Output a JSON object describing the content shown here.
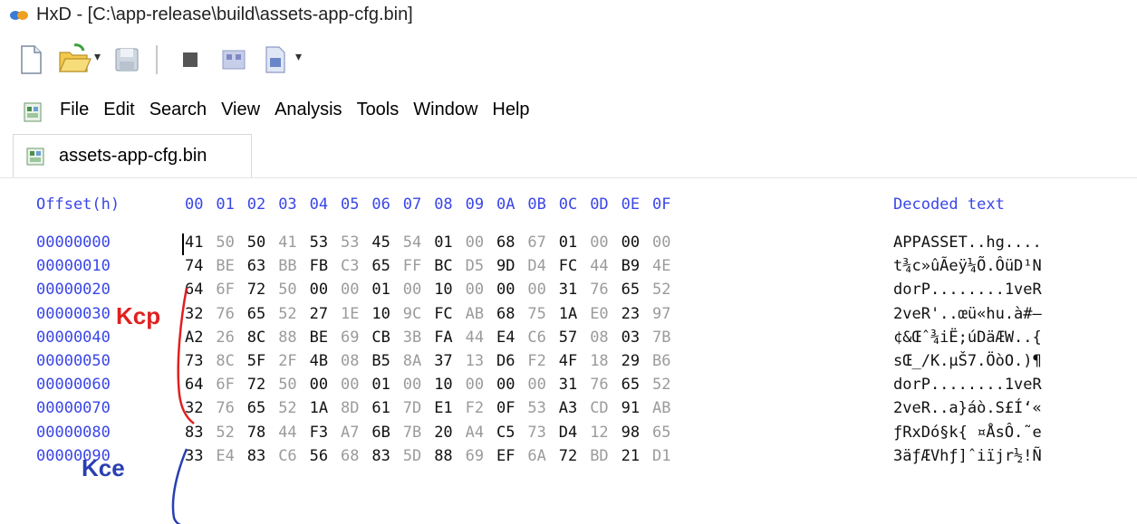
{
  "window": {
    "title": "HxD - [C:\\app-release\\build\\assets-app-cfg.bin]"
  },
  "toolbar": {
    "buttons": [
      {
        "icon": "new-file-icon"
      },
      {
        "icon": "open-folder-icon"
      },
      {
        "icon": "save-disk-icon"
      },
      {
        "icon": "close-icon"
      },
      {
        "icon": "ram-editor-icon"
      },
      {
        "icon": "disk-editor-icon"
      }
    ]
  },
  "menu": {
    "items": [
      "File",
      "Edit",
      "Search",
      "View",
      "Analysis",
      "Tools",
      "Window",
      "Help"
    ]
  },
  "tab": {
    "label": "assets-app-cfg.bin"
  },
  "hex_view": {
    "offset_header": "Offset(h)",
    "column_headers": [
      "00",
      "01",
      "02",
      "03",
      "04",
      "05",
      "06",
      "07",
      "08",
      "09",
      "0A",
      "0B",
      "0C",
      "0D",
      "0E",
      "0F"
    ],
    "decoded_header": "Decoded text",
    "rows": [
      {
        "offset": "00000000",
        "bytes": [
          "41",
          "50",
          "50",
          "41",
          "53",
          "53",
          "45",
          "54",
          "01",
          "00",
          "68",
          "67",
          "01",
          "00",
          "00",
          "00"
        ],
        "decoded": "APPASSET..hg...."
      },
      {
        "offset": "00000010",
        "bytes": [
          "74",
          "BE",
          "63",
          "BB",
          "FB",
          "C3",
          "65",
          "FF",
          "BC",
          "D5",
          "9D",
          "D4",
          "FC",
          "44",
          "B9",
          "4E"
        ],
        "decoded": "t¾c»ûÃeÿ¼Õ.ÔüD¹N"
      },
      {
        "offset": "00000020",
        "bytes": [
          "64",
          "6F",
          "72",
          "50",
          "00",
          "00",
          "01",
          "00",
          "10",
          "00",
          "00",
          "00",
          "31",
          "76",
          "65",
          "52"
        ],
        "decoded": "dorP........1veR"
      },
      {
        "offset": "00000030",
        "bytes": [
          "32",
          "76",
          "65",
          "52",
          "27",
          "1E",
          "10",
          "9C",
          "FC",
          "AB",
          "68",
          "75",
          "1A",
          "E0",
          "23",
          "97"
        ],
        "decoded": "2veR'..œü«hu.à#—"
      },
      {
        "offset": "00000040",
        "bytes": [
          "A2",
          "26",
          "8C",
          "88",
          "BE",
          "69",
          "CB",
          "3B",
          "FA",
          "44",
          "E4",
          "C6",
          "57",
          "08",
          "03",
          "7B"
        ],
        "decoded": "¢&Œˆ¾iË;úDäÆW..{"
      },
      {
        "offset": "00000050",
        "bytes": [
          "73",
          "8C",
          "5F",
          "2F",
          "4B",
          "08",
          "B5",
          "8A",
          "37",
          "13",
          "D6",
          "F2",
          "4F",
          "18",
          "29",
          "B6"
        ],
        "decoded": "sŒ_/K.µŠ7.ÖòO.)¶"
      },
      {
        "offset": "00000060",
        "bytes": [
          "64",
          "6F",
          "72",
          "50",
          "00",
          "00",
          "01",
          "00",
          "10",
          "00",
          "00",
          "00",
          "31",
          "76",
          "65",
          "52"
        ],
        "decoded": "dorP........1veR"
      },
      {
        "offset": "00000070",
        "bytes": [
          "32",
          "76",
          "65",
          "52",
          "1A",
          "8D",
          "61",
          "7D",
          "E1",
          "F2",
          "0F",
          "53",
          "A3",
          "CD",
          "91",
          "AB"
        ],
        "decoded": "2veR..a}áò.S£Í‘«"
      },
      {
        "offset": "00000080",
        "bytes": [
          "83",
          "52",
          "78",
          "44",
          "F3",
          "A7",
          "6B",
          "7B",
          "20",
          "A4",
          "C5",
          "73",
          "D4",
          "12",
          "98",
          "65"
        ],
        "decoded": "ƒRxDó§k{ ¤ÅsÔ.˜e"
      },
      {
        "offset": "00000090",
        "bytes": [
          "33",
          "E4",
          "83",
          "C6",
          "56",
          "68",
          "83",
          "5D",
          "88",
          "69",
          "EF",
          "6A",
          "72",
          "BD",
          "21",
          "D1"
        ],
        "decoded": "3äƒÆVhƒ]ˆiïjr½!Ñ"
      }
    ]
  },
  "annotations": {
    "kcp_label": "Kcp",
    "kcp_color": "#e02020",
    "kce_label": "Kce",
    "kce_color": "#2a3fb0"
  },
  "colors": {
    "offset_blue": "#3a46e8",
    "dim_byte": "#9b9b9b"
  }
}
